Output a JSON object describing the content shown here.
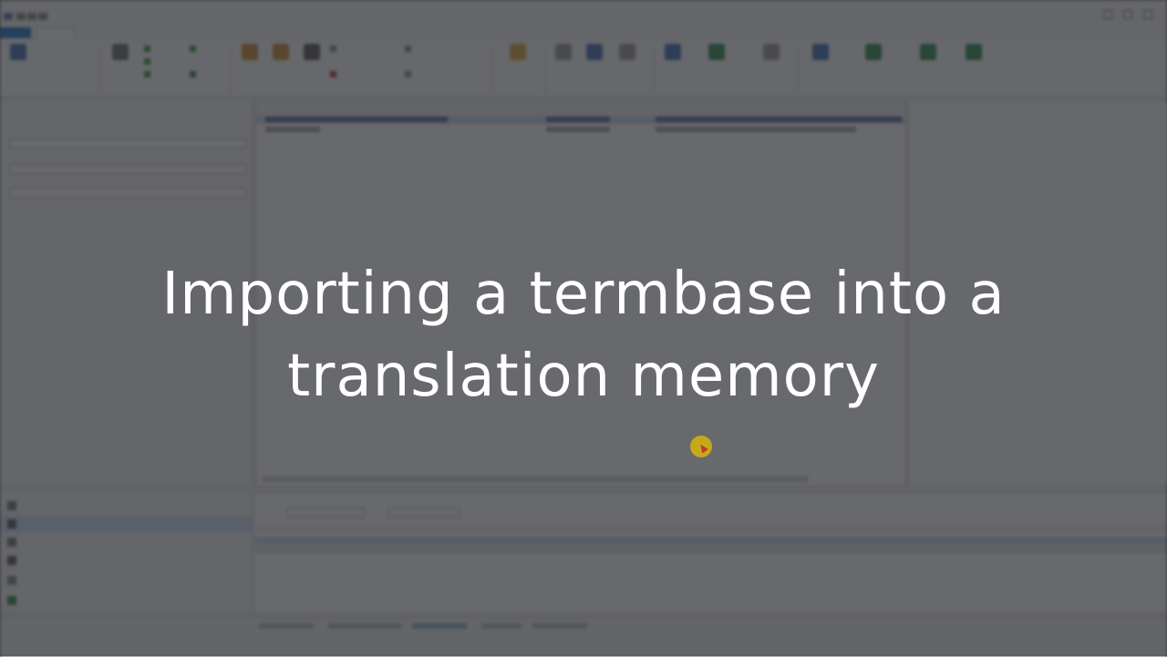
{
  "caption": {
    "line1": "Importing a termbase into a",
    "line2": "translation memory"
  },
  "colors": {
    "accent": "#1e73c8",
    "overlay": "#282a2e",
    "caption_text": "#ffffff",
    "cursor_highlight": "#e6be00"
  },
  "icons": {
    "cursor": "mouse-cursor-highlight-icon"
  }
}
